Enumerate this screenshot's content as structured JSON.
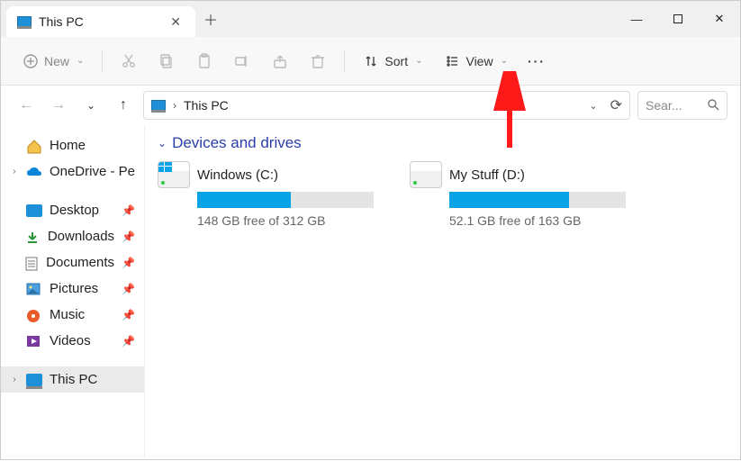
{
  "tab": {
    "title": "This PC"
  },
  "toolbar": {
    "new": "New",
    "sort": "Sort",
    "view": "View"
  },
  "breadcrumb": {
    "location": "This PC"
  },
  "search": {
    "placeholder": "Sear..."
  },
  "sidebar": {
    "home": "Home",
    "onedrive": "OneDrive - Pe",
    "desktop": "Desktop",
    "downloads": "Downloads",
    "documents": "Documents",
    "pictures": "Pictures",
    "music": "Music",
    "videos": "Videos",
    "thispc": "This PC"
  },
  "section": {
    "title": "Devices and drives"
  },
  "drives": [
    {
      "label": "Windows (C:)",
      "subtitle": "148 GB free of 312 GB",
      "fill_pct": 53,
      "has_winlogo": true
    },
    {
      "label": "My Stuff (D:)",
      "subtitle": "52.1 GB free of 163 GB",
      "fill_pct": 68,
      "has_winlogo": false
    }
  ]
}
